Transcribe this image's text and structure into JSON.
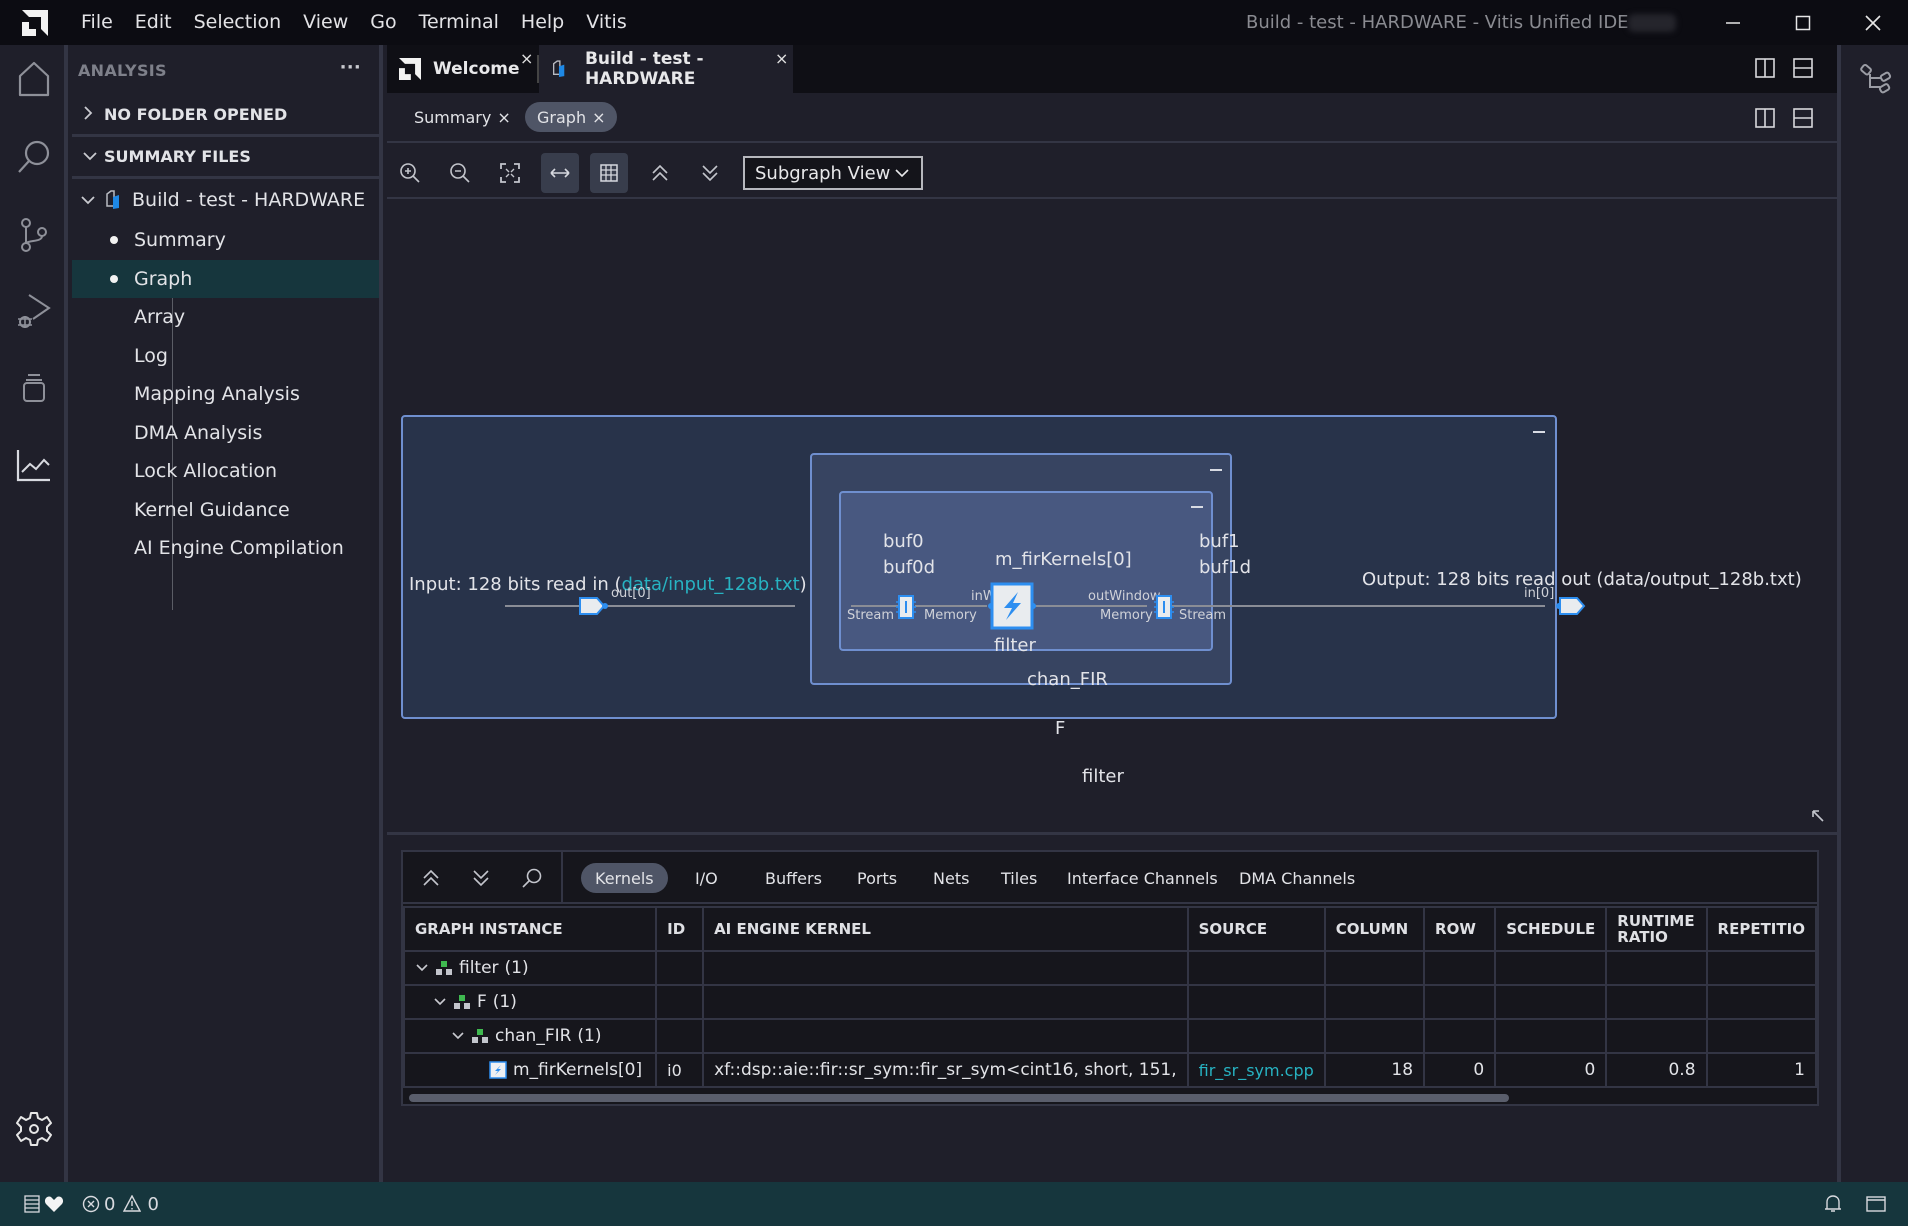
{
  "window": {
    "title": "Build - test - HARDWARE - Vitis Unified IDE",
    "menu": [
      "File",
      "Edit",
      "Selection",
      "View",
      "Go",
      "Terminal",
      "Help",
      "Vitis"
    ]
  },
  "activity_bar": {
    "items": [
      "home-icon",
      "search-icon",
      "source-control-icon",
      "run-debug-icon",
      "extensions-icon",
      "analysis-icon"
    ],
    "bottom": "settings-gear-icon"
  },
  "sidebar": {
    "title": "ANALYSIS",
    "more_label": "···",
    "sections": {
      "no_folder": "NO FOLDER OPENED",
      "summary_files": "SUMMARY FILES"
    },
    "root": "Build - test - HARDWARE",
    "items": [
      {
        "label": "Summary",
        "dot": true
      },
      {
        "label": "Graph",
        "dot": true,
        "active": true
      },
      {
        "label": "Array",
        "dot": false
      },
      {
        "label": "Log",
        "dot": false
      },
      {
        "label": "Mapping Analysis",
        "dot": false
      },
      {
        "label": "DMA Analysis",
        "dot": false
      },
      {
        "label": "Lock Allocation",
        "dot": false
      },
      {
        "label": "Kernel Guidance",
        "dot": false
      },
      {
        "label": "AI Engine Compilation",
        "dot": false
      }
    ]
  },
  "editor": {
    "tabs": [
      {
        "label": "Welcome",
        "close": "×"
      },
      {
        "label": "Build - test - HARDWARE",
        "close": "×",
        "active": true
      }
    ],
    "subtabs": [
      {
        "label": "Summary",
        "close": "×"
      },
      {
        "label": "Graph",
        "close": "×",
        "active": true
      }
    ],
    "toolbar": {
      "buttons": [
        "zoom-in",
        "zoom-out",
        "fit-to-screen",
        "horizontal-layout",
        "table-view",
        "collapse-all",
        "expand-all"
      ],
      "view_select": "Subgraph View"
    }
  },
  "graph": {
    "outer_label": "filter",
    "f_label": "F",
    "chan_label": "chan_FIR",
    "kernel_group_label": "filter",
    "input": {
      "prefix": "Input: 128 bits read in (",
      "file": "data/input_128b.txt",
      "suffix": ")",
      "port": "out[0]"
    },
    "output": {
      "text": "Output: 128 bits read out (data/output_128b.txt)",
      "port": "in[0]"
    },
    "buffer_in": {
      "name1": "buf0",
      "name2": "buf0d",
      "left": "Stream",
      "right": "Memory"
    },
    "buffer_out": {
      "name1": "buf1",
      "name2": "buf1d",
      "left": "Memory",
      "right": "Stream"
    },
    "kernel": {
      "name": "m_firKernels[0]",
      "in_port": "inWindow",
      "out_port": "outWindow"
    }
  },
  "bottom_panel": {
    "tabs": [
      "Kernels",
      "I/O",
      "Buffers",
      "Ports",
      "Nets",
      "Tiles",
      "Interface Channels",
      "DMA Channels"
    ],
    "active_tab": "Kernels",
    "columns": [
      "GRAPH INSTANCE",
      "ID",
      "AI ENGINE KERNEL",
      "SOURCE",
      "COLUMN",
      "ROW",
      "SCHEDULE",
      "RUNTIME RATIO",
      "REPETITIO"
    ],
    "rows": [
      {
        "instance": "filter",
        "count": "(1)",
        "level": 0,
        "type": "graph"
      },
      {
        "instance": "F",
        "count": "(1)",
        "level": 1,
        "type": "graph"
      },
      {
        "instance": "chan_FIR",
        "count": "(1)",
        "level": 2,
        "type": "graph"
      },
      {
        "instance": "m_firKernels[0]",
        "level": 3,
        "type": "kernel",
        "id": "i0",
        "kernel": "xf::dsp::aie::fir::sr_sym::fir_sr_sym<cint16, short, 151,",
        "source": "fir_sr_sym.cpp",
        "column": "18",
        "row": "0",
        "schedule": "0",
        "runtime_ratio": "0.8",
        "repetition": "1"
      }
    ]
  },
  "status_bar": {
    "errors": "0",
    "warnings": "0"
  },
  "colors": {
    "accent_link": "#27b3c2",
    "graph_border": "#6f8fcf",
    "status_bar": "#16363d"
  }
}
